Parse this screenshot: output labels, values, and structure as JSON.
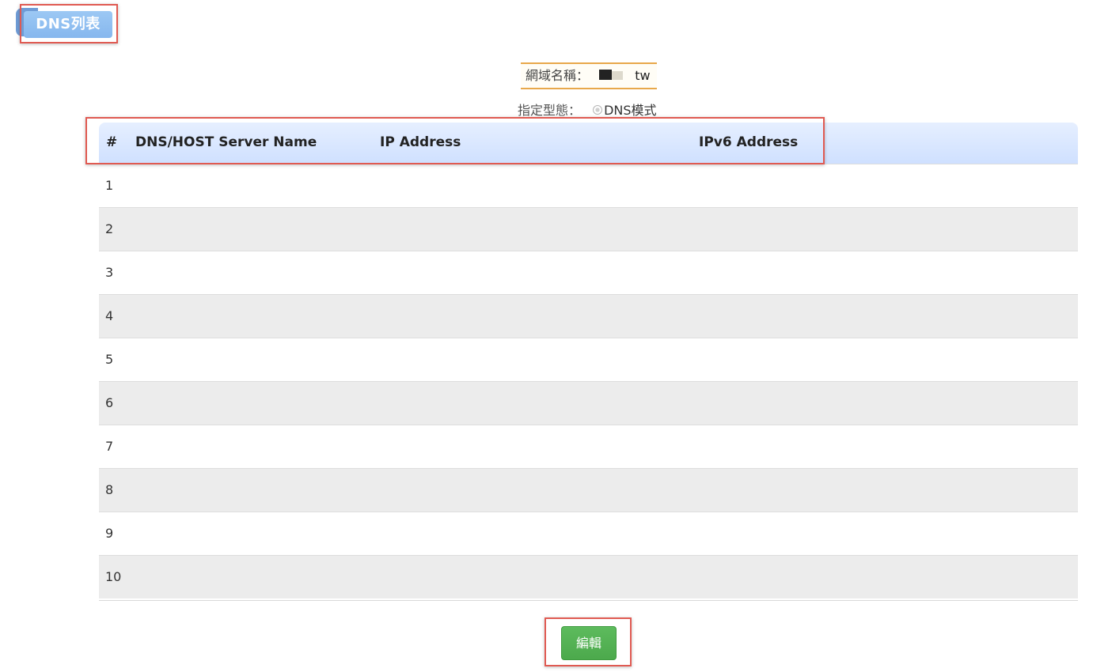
{
  "tab": {
    "label": "DNS列表"
  },
  "domain": {
    "label": "網域名稱：",
    "value": "tw"
  },
  "assign_type": {
    "label": "指定型態：",
    "value": "DNS模式"
  },
  "table": {
    "headers": {
      "num": "#",
      "name": "DNS/HOST Server Name",
      "ip": "IP Address",
      "ipv6": "IPv6 Address"
    },
    "rows": [
      "1",
      "2",
      "3",
      "4",
      "5",
      "6",
      "7",
      "8",
      "9",
      "10"
    ]
  },
  "edit_button": {
    "label": "編輯"
  },
  "colors": {
    "tab": "#8fbef0",
    "header_bg": "#d6e5ff",
    "stripe": "#ececec",
    "edit_button": "#55b255",
    "highlight": "#e05a52",
    "domain_border": "#e8a84a"
  }
}
